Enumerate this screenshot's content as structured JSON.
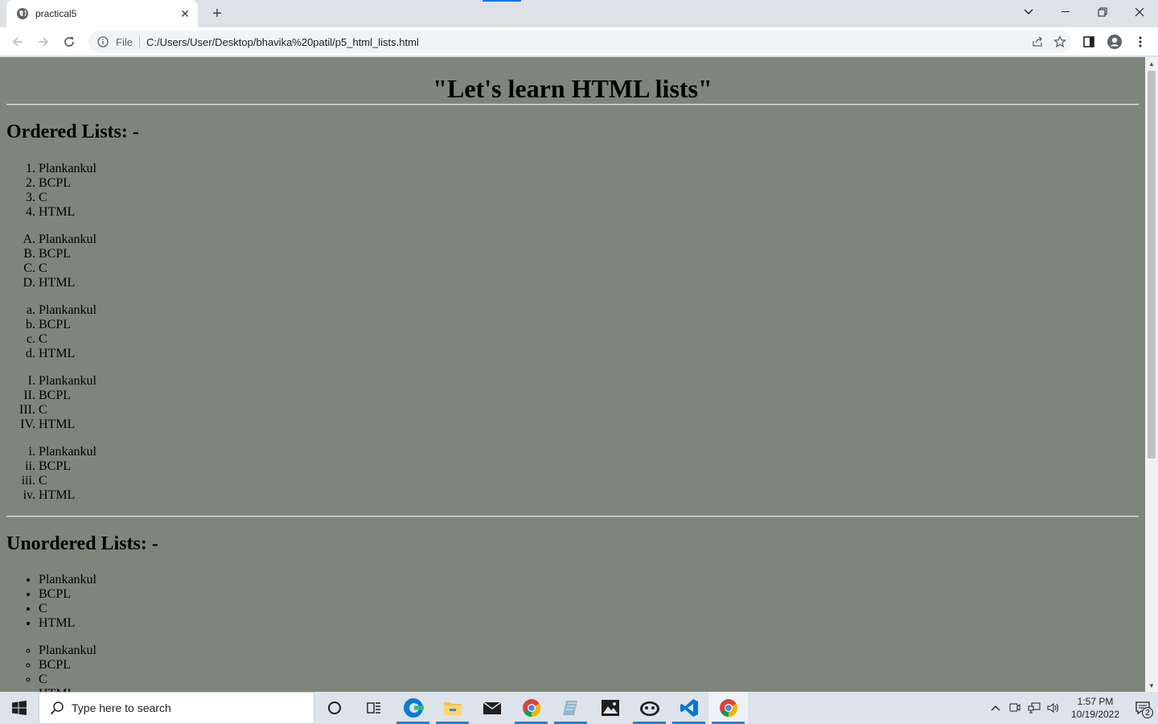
{
  "browser": {
    "tab_title": "practical5",
    "url_scheme_label": "File",
    "url": "C:/Users/User/Desktop/bhavika%20patil/p5_html_lists.html"
  },
  "page": {
    "title": "\"Let's learn HTML lists\"",
    "ordered_heading": "Ordered Lists: -",
    "unordered_heading": "Unordered Lists: -",
    "ordered_lists": [
      {
        "type": "1",
        "items": [
          "Plankankul",
          "BCPL",
          "C",
          "HTML"
        ]
      },
      {
        "type": "A",
        "items": [
          "Plankankul",
          "BCPL",
          "C",
          "HTML"
        ]
      },
      {
        "type": "a",
        "items": [
          "Plankankul",
          "BCPL",
          "C",
          "HTML"
        ]
      },
      {
        "type": "I",
        "items": [
          "Plankankul",
          "BCPL",
          "C",
          "HTML"
        ]
      },
      {
        "type": "i",
        "items": [
          "Plankankul",
          "BCPL",
          "C",
          "HTML"
        ]
      }
    ],
    "unordered_lists": [
      {
        "type": "disc",
        "items": [
          "Plankankul",
          "BCPL",
          "C",
          "HTML"
        ]
      },
      {
        "type": "circle",
        "items": [
          "Plankankul",
          "BCPL",
          "C",
          "HTML"
        ]
      }
    ],
    "background_color": "#7e867b"
  },
  "taskbar": {
    "search_placeholder": "Type here to search",
    "time": "1:57 PM",
    "date": "10/19/2022",
    "notification_count": "2"
  }
}
